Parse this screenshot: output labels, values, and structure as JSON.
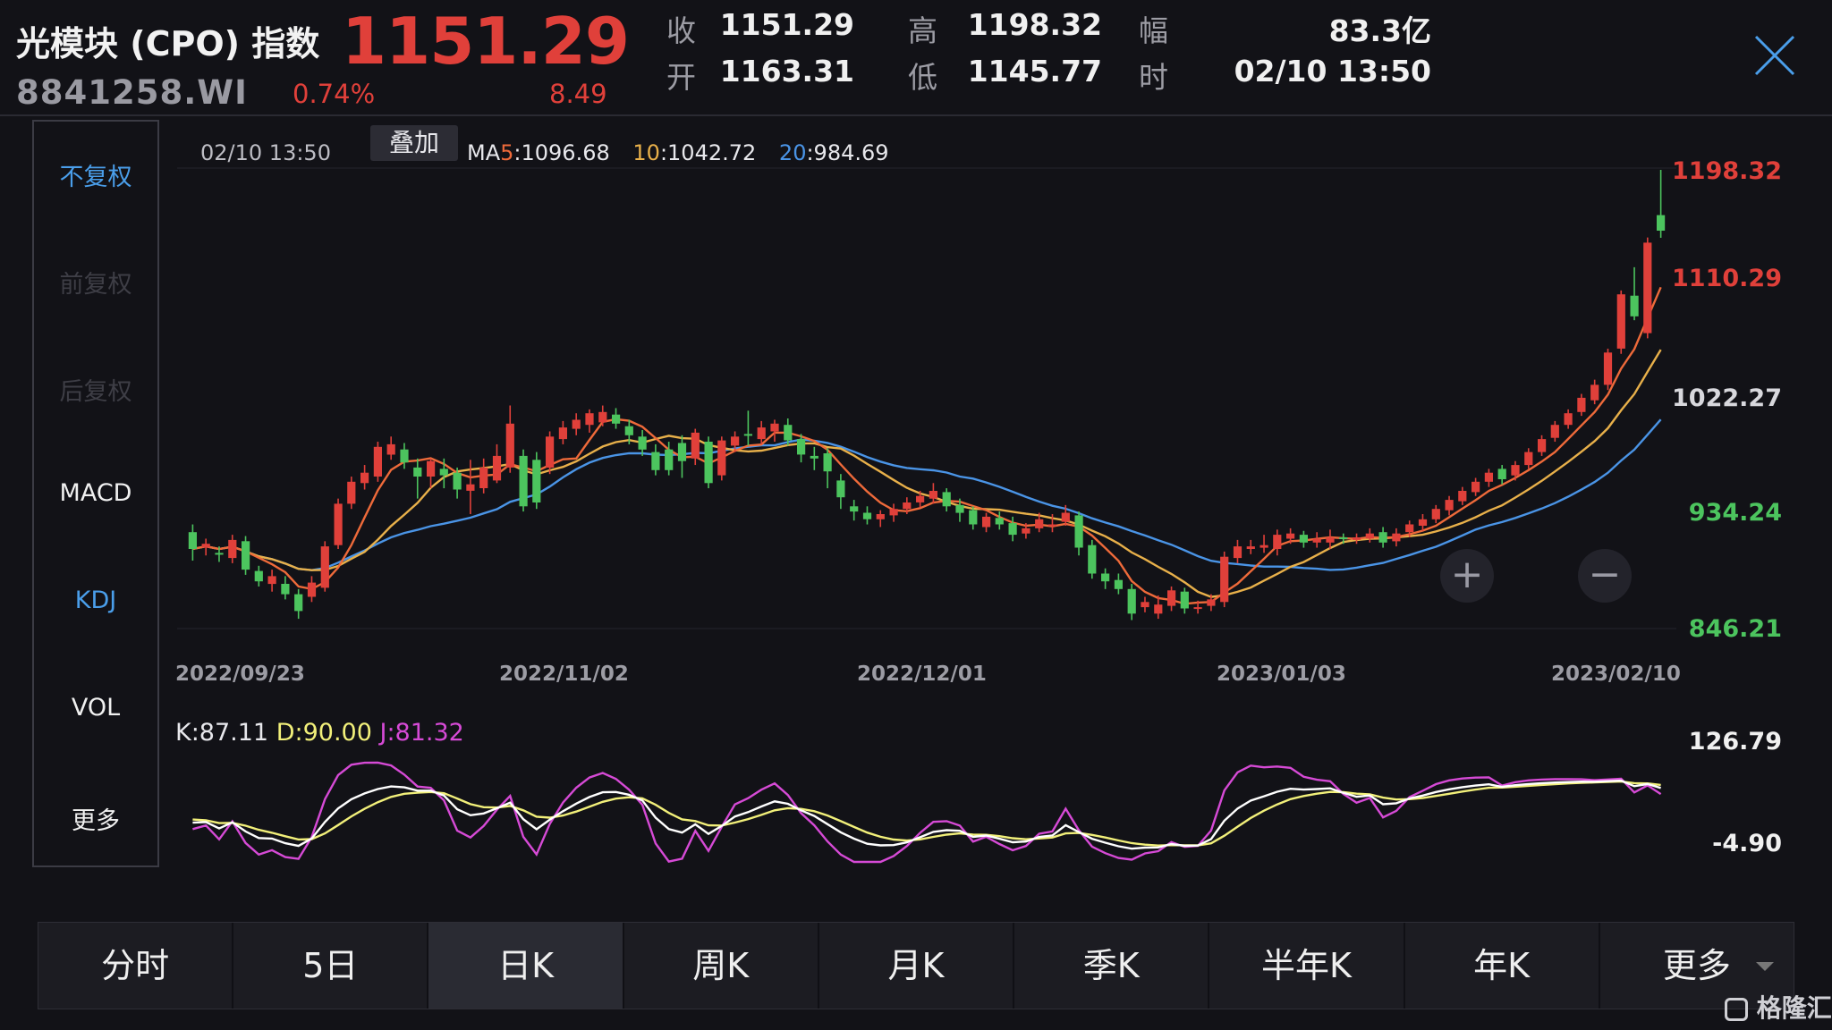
{
  "header": {
    "title": "光模块 (CPO) 指数",
    "code": "8841258.WI",
    "price": "1151.29",
    "change_pct": "0.74%",
    "change": "8.49",
    "quotes": [
      {
        "label": "收",
        "value": "1151.29"
      },
      {
        "label": "高",
        "value": "1198.32"
      },
      {
        "label": "幅",
        "value": "83.3亿"
      },
      {
        "label": "开",
        "value": "1163.31"
      },
      {
        "label": "低",
        "value": "1145.77"
      },
      {
        "label": "时",
        "value": "02/10 13:50"
      }
    ]
  },
  "left_panel": {
    "items": [
      "不复权",
      "前复权",
      "后复权",
      "MACD",
      "KDJ",
      "VOL",
      "更多"
    ]
  },
  "chart_toolbar": {
    "time": "02/10 13:50",
    "overlay": "叠加",
    "ma_prefix": "MA",
    "ma5_label": "5",
    "ma5_value": ":1096.68",
    "ma10_label": "10",
    "ma10_value": ":1042.72",
    "ma20_label": "20",
    "ma20_value": ":984.69"
  },
  "kdj_labels": {
    "k": "K:87.11",
    "d": "D:90.00",
    "j": "J:81.32",
    "top": "126.79",
    "bottom": "-4.90"
  },
  "bottom_tabs": [
    "分时",
    "5日",
    "日K",
    "周K",
    "月K",
    "季K",
    "半年K",
    "年K",
    "更多"
  ],
  "active_tab": "日K",
  "zoom": {
    "in": "+",
    "out": "−"
  },
  "watermark": "格隆汇",
  "colors": {
    "up": "#e0403a",
    "down": "#4cc45e",
    "ma5": "#ee6a3a",
    "ma10": "#e8b04a",
    "ma20": "#4a94e6",
    "k": "#ffffff",
    "d": "#f2f07a",
    "j": "#d64ad6",
    "accent_blue": "#4a9eea"
  },
  "chart_data": [
    {
      "type": "candlestick",
      "x_labels": [
        "2022/09/23",
        "2022/11/02",
        "2022/12/01",
        "2023/01/03",
        "2023/02/10"
      ],
      "y_ticks": [
        "1198.32",
        "1110.29",
        "1022.27",
        "934.24",
        "846.21"
      ],
      "ylim": [
        846.21,
        1198.32
      ],
      "series_ma": [
        {
          "name": "MA5",
          "last": 1096.68
        },
        {
          "name": "MA10",
          "last": 1042.72
        },
        {
          "name": "MA20",
          "last": 984.69
        }
      ],
      "candles": [
        {
          "o": 918,
          "c": 905,
          "h": 924,
          "l": 896
        },
        {
          "o": 906,
          "c": 909,
          "h": 913,
          "l": 900
        },
        {
          "o": 902,
          "c": 901,
          "h": 907,
          "l": 895
        },
        {
          "o": 898,
          "c": 912,
          "h": 916,
          "l": 894
        },
        {
          "o": 911,
          "c": 889,
          "h": 915,
          "l": 885
        },
        {
          "o": 888,
          "c": 880,
          "h": 892,
          "l": 876
        },
        {
          "o": 878,
          "c": 884,
          "h": 889,
          "l": 872
        },
        {
          "o": 878,
          "c": 870,
          "h": 884,
          "l": 866
        },
        {
          "o": 870,
          "c": 857,
          "h": 874,
          "l": 851
        },
        {
          "o": 868,
          "c": 879,
          "h": 884,
          "l": 864
        },
        {
          "o": 875,
          "c": 907,
          "h": 911,
          "l": 872
        },
        {
          "o": 908,
          "c": 940,
          "h": 944,
          "l": 905
        },
        {
          "o": 940,
          "c": 957,
          "h": 961,
          "l": 936
        },
        {
          "o": 956,
          "c": 964,
          "h": 970,
          "l": 951
        },
        {
          "o": 961,
          "c": 984,
          "h": 988,
          "l": 957
        },
        {
          "o": 978,
          "c": 986,
          "h": 992,
          "l": 974
        },
        {
          "o": 982,
          "c": 972,
          "h": 987,
          "l": 967
        },
        {
          "o": 968,
          "c": 961,
          "h": 975,
          "l": 944
        },
        {
          "o": 961,
          "c": 973,
          "h": 975,
          "l": 952
        },
        {
          "o": 967,
          "c": 962,
          "h": 975,
          "l": 952
        },
        {
          "o": 964,
          "c": 951,
          "h": 968,
          "l": 944
        },
        {
          "o": 950,
          "c": 955,
          "h": 974,
          "l": 932
        },
        {
          "o": 952,
          "c": 968,
          "h": 975,
          "l": 948
        },
        {
          "o": 958,
          "c": 977,
          "h": 986,
          "l": 956
        },
        {
          "o": 968,
          "c": 1002,
          "h": 1016,
          "l": 964
        },
        {
          "o": 977,
          "c": 938,
          "h": 982,
          "l": 934
        },
        {
          "o": 974,
          "c": 941,
          "h": 980,
          "l": 936
        },
        {
          "o": 968,
          "c": 992,
          "h": 996,
          "l": 963
        },
        {
          "o": 990,
          "c": 999,
          "h": 1004,
          "l": 986
        },
        {
          "o": 998,
          "c": 1005,
          "h": 1010,
          "l": 993
        },
        {
          "o": 1001,
          "c": 1010,
          "h": 1013,
          "l": 995
        },
        {
          "o": 1003,
          "c": 1011,
          "h": 1016,
          "l": 1000
        },
        {
          "o": 1009,
          "c": 1002,
          "h": 1014,
          "l": 998
        },
        {
          "o": 1000,
          "c": 993,
          "h": 1005,
          "l": 986
        },
        {
          "o": 992,
          "c": 982,
          "h": 997,
          "l": 977
        },
        {
          "o": 980,
          "c": 966,
          "h": 986,
          "l": 962
        },
        {
          "o": 982,
          "c": 966,
          "h": 988,
          "l": 962
        },
        {
          "o": 987,
          "c": 973,
          "h": 993,
          "l": 960
        },
        {
          "o": 975,
          "c": 995,
          "h": 998,
          "l": 970
        },
        {
          "o": 988,
          "c": 956,
          "h": 992,
          "l": 952
        },
        {
          "o": 962,
          "c": 989,
          "h": 992,
          "l": 958
        },
        {
          "o": 985,
          "c": 992,
          "h": 996,
          "l": 980
        },
        {
          "o": 994,
          "c": 993,
          "h": 1012,
          "l": 985
        },
        {
          "o": 990,
          "c": 999,
          "h": 1004,
          "l": 986
        },
        {
          "o": 996,
          "c": 1002,
          "h": 1005,
          "l": 988
        },
        {
          "o": 1001,
          "c": 989,
          "h": 1006,
          "l": 985
        },
        {
          "o": 990,
          "c": 978,
          "h": 994,
          "l": 972
        },
        {
          "o": 977,
          "c": 975,
          "h": 984,
          "l": 966
        },
        {
          "o": 979,
          "c": 965,
          "h": 983,
          "l": 952
        },
        {
          "o": 958,
          "c": 945,
          "h": 963,
          "l": 936
        },
        {
          "o": 938,
          "c": 934,
          "h": 943,
          "l": 927
        },
        {
          "o": 933,
          "c": 928,
          "h": 938,
          "l": 924
        },
        {
          "o": 928,
          "c": 932,
          "h": 935,
          "l": 922
        },
        {
          "o": 931,
          "c": 936,
          "h": 940,
          "l": 926
        },
        {
          "o": 936,
          "c": 941,
          "h": 945,
          "l": 932
        },
        {
          "o": 941,
          "c": 946,
          "h": 950,
          "l": 937
        },
        {
          "o": 944,
          "c": 950,
          "h": 956,
          "l": 940
        },
        {
          "o": 949,
          "c": 938,
          "h": 952,
          "l": 934
        },
        {
          "o": 939,
          "c": 933,
          "h": 944,
          "l": 926
        },
        {
          "o": 935,
          "c": 924,
          "h": 938,
          "l": 920
        },
        {
          "o": 922,
          "c": 930,
          "h": 933,
          "l": 918
        },
        {
          "o": 929,
          "c": 924,
          "h": 934,
          "l": 920
        },
        {
          "o": 925,
          "c": 916,
          "h": 930,
          "l": 911
        },
        {
          "o": 917,
          "c": 921,
          "h": 925,
          "l": 913
        },
        {
          "o": 921,
          "c": 928,
          "h": 933,
          "l": 918
        },
        {
          "o": 924,
          "c": 924,
          "h": 932,
          "l": 918
        },
        {
          "o": 926,
          "c": 933,
          "h": 939,
          "l": 923
        },
        {
          "o": 931,
          "c": 906,
          "h": 934,
          "l": 900
        },
        {
          "o": 908,
          "c": 886,
          "h": 912,
          "l": 882
        },
        {
          "o": 886,
          "c": 880,
          "h": 890,
          "l": 874
        },
        {
          "o": 881,
          "c": 874,
          "h": 886,
          "l": 870
        },
        {
          "o": 874,
          "c": 855,
          "h": 878,
          "l": 850
        },
        {
          "o": 860,
          "c": 864,
          "h": 868,
          "l": 856
        },
        {
          "o": 855,
          "c": 862,
          "h": 869,
          "l": 851
        },
        {
          "o": 861,
          "c": 873,
          "h": 876,
          "l": 857
        },
        {
          "o": 872,
          "c": 859,
          "h": 875,
          "l": 855
        },
        {
          "o": 859,
          "c": 860,
          "h": 865,
          "l": 855
        },
        {
          "o": 861,
          "c": 866,
          "h": 870,
          "l": 857
        },
        {
          "o": 864,
          "c": 899,
          "h": 903,
          "l": 860
        },
        {
          "o": 898,
          "c": 907,
          "h": 912,
          "l": 894
        },
        {
          "o": 905,
          "c": 907,
          "h": 912,
          "l": 901
        },
        {
          "o": 906,
          "c": 908,
          "h": 916,
          "l": 902
        },
        {
          "o": 905,
          "c": 916,
          "h": 920,
          "l": 900
        },
        {
          "o": 913,
          "c": 917,
          "h": 921,
          "l": 909
        },
        {
          "o": 916,
          "c": 910,
          "h": 919,
          "l": 906
        },
        {
          "o": 910,
          "c": 913,
          "h": 918,
          "l": 906
        },
        {
          "o": 910,
          "c": 914,
          "h": 920,
          "l": 905
        },
        {
          "o": 914,
          "c": 913,
          "h": 917,
          "l": 909
        },
        {
          "o": 912,
          "c": 914,
          "h": 917,
          "l": 909
        },
        {
          "o": 913,
          "c": 917,
          "h": 921,
          "l": 910
        },
        {
          "o": 918,
          "c": 910,
          "h": 922,
          "l": 906
        },
        {
          "o": 911,
          "c": 917,
          "h": 921,
          "l": 907
        },
        {
          "o": 918,
          "c": 924,
          "h": 927,
          "l": 914
        },
        {
          "o": 923,
          "c": 928,
          "h": 932,
          "l": 919
        },
        {
          "o": 928,
          "c": 936,
          "h": 939,
          "l": 925
        },
        {
          "o": 935,
          "c": 943,
          "h": 946,
          "l": 931
        },
        {
          "o": 942,
          "c": 950,
          "h": 953,
          "l": 939
        },
        {
          "o": 949,
          "c": 957,
          "h": 960,
          "l": 946
        },
        {
          "o": 957,
          "c": 964,
          "h": 967,
          "l": 953
        },
        {
          "o": 967,
          "c": 959,
          "h": 970,
          "l": 955
        },
        {
          "o": 962,
          "c": 970,
          "h": 973,
          "l": 958
        },
        {
          "o": 970,
          "c": 980,
          "h": 983,
          "l": 967
        },
        {
          "o": 980,
          "c": 990,
          "h": 993,
          "l": 977
        },
        {
          "o": 991,
          "c": 1001,
          "h": 1004,
          "l": 988
        },
        {
          "o": 1001,
          "c": 1010,
          "h": 1013,
          "l": 998
        },
        {
          "o": 1011,
          "c": 1022,
          "h": 1025,
          "l": 1008
        },
        {
          "o": 1020,
          "c": 1032,
          "h": 1036,
          "l": 1017
        },
        {
          "o": 1032,
          "c": 1057,
          "h": 1060,
          "l": 1028
        },
        {
          "o": 1060,
          "c": 1102,
          "h": 1105,
          "l": 1056
        },
        {
          "o": 1101,
          "c": 1085,
          "h": 1123,
          "l": 1082
        },
        {
          "o": 1072,
          "c": 1142,
          "h": 1146,
          "l": 1068
        },
        {
          "o": 1163.31,
          "c": 1151.29,
          "h": 1198.32,
          "l": 1145.77
        }
      ]
    },
    {
      "type": "line",
      "name": "KDJ",
      "ylim": [
        -4.9,
        126.79
      ],
      "series": [
        {
          "name": "K",
          "last": 87.11
        },
        {
          "name": "D",
          "last": 90.0
        },
        {
          "name": "J",
          "last": 81.32
        }
      ]
    }
  ]
}
